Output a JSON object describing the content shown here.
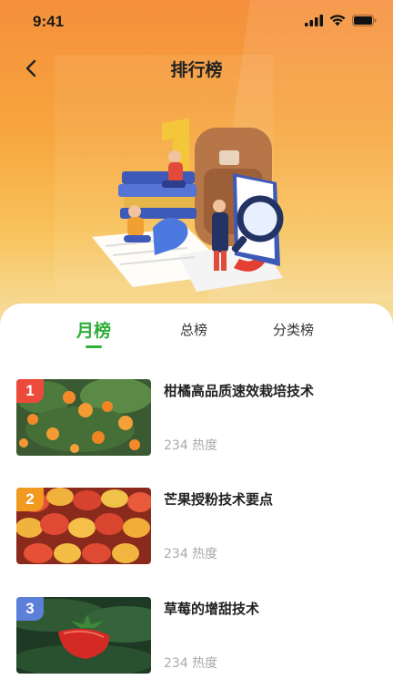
{
  "status": {
    "time": "9:41"
  },
  "nav": {
    "title": "排行榜"
  },
  "tabs": [
    {
      "label": "月榜",
      "active": true
    },
    {
      "label": "总榜",
      "active": false
    },
    {
      "label": "分类榜",
      "active": false
    }
  ],
  "items": [
    {
      "rank": "1",
      "title": "柑橘高品质速效栽培技术",
      "meta": "234 热度",
      "image": "orange-tree"
    },
    {
      "rank": "2",
      "title": "芒果授粉技术要点",
      "meta": "234 热度",
      "image": "mango-pile"
    },
    {
      "rank": "3",
      "title": "草莓的增甜技术",
      "meta": "234 热度",
      "image": "strawberry"
    }
  ],
  "colors": {
    "accent": "#2fae3a",
    "rank1": "#ec4a3a",
    "rank2": "#f19a1f",
    "rank3": "#5c7fd8",
    "header": "#f7a53e"
  }
}
